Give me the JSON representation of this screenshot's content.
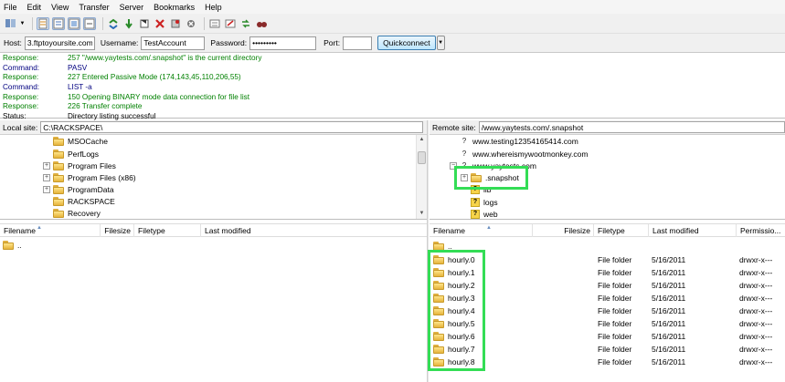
{
  "menu": [
    "File",
    "Edit",
    "View",
    "Transfer",
    "Server",
    "Bookmarks",
    "Help"
  ],
  "toolbar_icons": [
    "site-manager-icon",
    "dropdown-arrow-icon",
    "toggle-log-icon",
    "toggle-local-tree-icon",
    "toggle-remote-tree-icon",
    "toggle-queue-icon",
    "refresh-icon",
    "process-queue-icon",
    "cancel-operation-icon",
    "disconnect-icon",
    "reconnect-icon",
    "filter-icon",
    "compare-icon",
    "sync-browse-icon",
    "search-icon"
  ],
  "quickconnect": {
    "host_label": "Host:",
    "host_value": "3.ftptoyoursite.com",
    "user_label": "Username:",
    "user_value": "TestAccount",
    "pass_label": "Password:",
    "pass_value": "•••••••••",
    "port_label": "Port:",
    "port_value": "",
    "button": "Quickconnect",
    "dropdown": "▼"
  },
  "log": [
    {
      "type": "Response:",
      "text": "257 \"/www.yaytests.com/.snapshot\" is the current directory",
      "color": "green"
    },
    {
      "type": "Command:",
      "text": "PASV",
      "color": "blue"
    },
    {
      "type": "Response:",
      "text": "227 Entered Passive Mode (174,143,45,110,206,55)",
      "color": "green"
    },
    {
      "type": "Command:",
      "text": "LIST -a",
      "color": "blue"
    },
    {
      "type": "Response:",
      "text": "150 Opening BINARY mode data connection for file list",
      "color": "green"
    },
    {
      "type": "Response:",
      "text": "226 Transfer complete",
      "color": "green"
    },
    {
      "type": "Status:",
      "text": "Directory listing successful",
      "color": "black"
    }
  ],
  "local": {
    "site_label": "Local site:",
    "site_path": "C:\\RACKSPACE\\",
    "tree": [
      {
        "label": "MSOCache",
        "expander": ""
      },
      {
        "label": "PerfLogs",
        "expander": ""
      },
      {
        "label": "Program Files",
        "expander": "+"
      },
      {
        "label": "Program Files (x86)",
        "expander": "+"
      },
      {
        "label": "ProgramData",
        "expander": "+"
      },
      {
        "label": "RACKSPACE",
        "expander": ""
      },
      {
        "label": "Recovery",
        "expander": ""
      }
    ],
    "columns": [
      "Filename",
      "Filesize",
      "Filetype",
      "Last modified"
    ],
    "rows": [
      ".."
    ]
  },
  "remote": {
    "site_label": "Remote site:",
    "site_path": "/www.yaytests.com/.snapshot",
    "tree": [
      {
        "label": "www.testing12354165414.com",
        "kind": "globe",
        "expander": ""
      },
      {
        "label": "www.whereismywootmonkey.com",
        "kind": "globe",
        "expander": ""
      },
      {
        "label": "www.yaytests.com",
        "kind": "globe",
        "expander": "−"
      },
      {
        "label": ".snapshot",
        "kind": "folder",
        "expander": "+"
      },
      {
        "label": "lib",
        "kind": "unknown",
        "expander": ""
      },
      {
        "label": "logs",
        "kind": "unknown",
        "expander": ""
      },
      {
        "label": "web",
        "kind": "unknown",
        "expander": ""
      }
    ],
    "columns": [
      "Filename",
      "Filesize",
      "Filetype",
      "Last modified",
      "Permissio..."
    ],
    "parent_row": "..",
    "rows": [
      {
        "name": "hourly.0",
        "type": "File folder",
        "modified": "5/16/2011",
        "perms": "drwxr-x---"
      },
      {
        "name": "hourly.1",
        "type": "File folder",
        "modified": "5/16/2011",
        "perms": "drwxr-x---"
      },
      {
        "name": "hourly.2",
        "type": "File folder",
        "modified": "5/16/2011",
        "perms": "drwxr-x---"
      },
      {
        "name": "hourly.3",
        "type": "File folder",
        "modified": "5/16/2011",
        "perms": "drwxr-x---"
      },
      {
        "name": "hourly.4",
        "type": "File folder",
        "modified": "5/16/2011",
        "perms": "drwxr-x---"
      },
      {
        "name": "hourly.5",
        "type": "File folder",
        "modified": "5/16/2011",
        "perms": "drwxr-x---"
      },
      {
        "name": "hourly.6",
        "type": "File folder",
        "modified": "5/16/2011",
        "perms": "drwxr-x---"
      },
      {
        "name": "hourly.7",
        "type": "File folder",
        "modified": "5/16/2011",
        "perms": "drwxr-x---"
      },
      {
        "name": "hourly.8",
        "type": "File folder",
        "modified": "5/16/2011",
        "perms": "drwxr-x---"
      }
    ]
  },
  "colors": {
    "response": "#008000",
    "command": "#000080",
    "highlight": "#33dd55"
  }
}
